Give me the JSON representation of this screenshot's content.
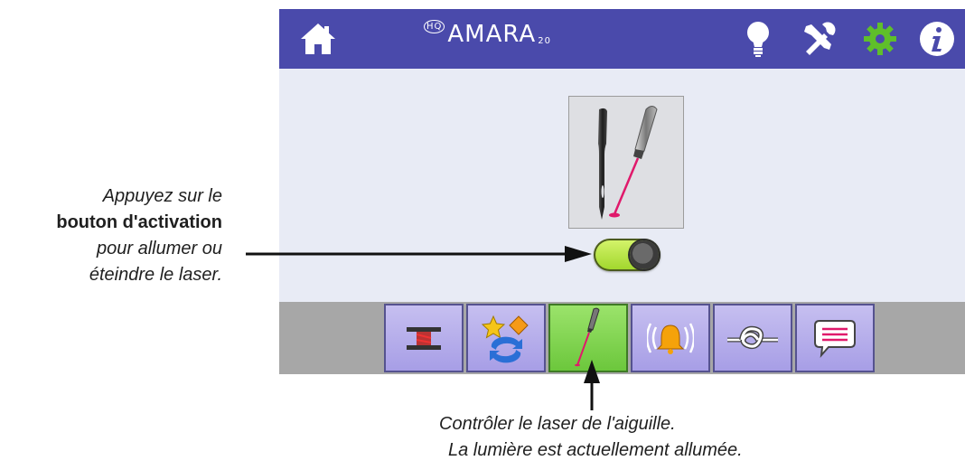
{
  "app": {
    "logo_prefix": "HQ",
    "logo_text": "AMARA",
    "logo_suffix": "20"
  },
  "topbar_icons": [
    "home-icon",
    "lightbulb-icon",
    "tools-icon",
    "gear-icon",
    "info-icon"
  ],
  "colors": {
    "topbar": "#4a4aab",
    "screen_bg": "#e8ebf5",
    "tab_bg": "#a79ee6",
    "tab_active": "#6cc73c",
    "toggle_on": "#b9e63f",
    "laser": "#e0196b"
  },
  "laser_control": {
    "state": "on"
  },
  "tabs": [
    {
      "icon": "thread-spool-icon",
      "active": false
    },
    {
      "icon": "star-diamond-swap-icon",
      "active": false
    },
    {
      "icon": "needle-laser-icon",
      "active": true
    },
    {
      "icon": "alarm-bell-icon",
      "active": false
    },
    {
      "icon": "knot-icon",
      "active": false
    },
    {
      "icon": "message-icon",
      "active": false
    }
  ],
  "annotations": {
    "left_line1": "Appuyez sur le",
    "left_line2": "bouton d'activation",
    "left_line3": "pour allumer ou",
    "left_line4": "éteindre le laser.",
    "bottom_line1": "Contrôler le laser de l'aiguille.",
    "bottom_line2": "La lumière est actuellement allumée."
  }
}
